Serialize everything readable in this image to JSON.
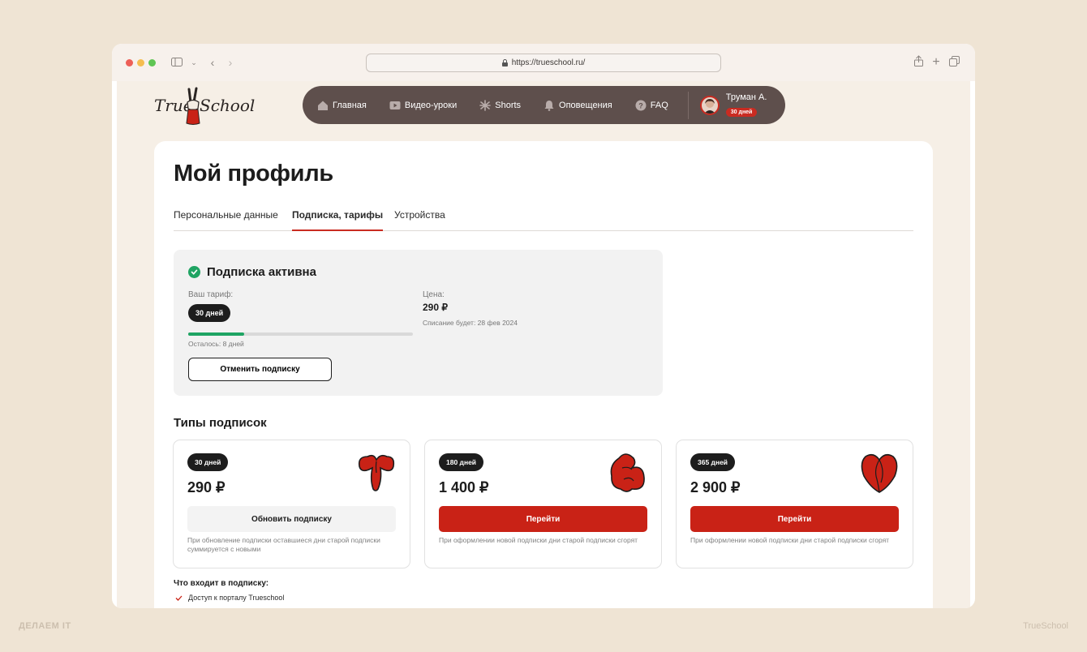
{
  "browser": {
    "url": "https://trueschool.ru/"
  },
  "brand": {
    "logo_left": "True",
    "logo_right": "School"
  },
  "nav": {
    "items": [
      {
        "label": "Главная",
        "icon": "home-icon"
      },
      {
        "label": "Видео-уроки",
        "icon": "video-icon"
      },
      {
        "label": "Shorts",
        "icon": "shorts-icon"
      },
      {
        "label": "Оповещения",
        "icon": "bell-icon"
      },
      {
        "label": "FAQ",
        "icon": "question-icon"
      }
    ],
    "user": {
      "name": "Труман А.",
      "badge": "30 дней"
    }
  },
  "profile": {
    "title": "Мой профиль",
    "tabs": [
      {
        "label": "Персональные данные",
        "active": false
      },
      {
        "label": "Подписка, тарифы",
        "active": true
      },
      {
        "label": "Устройства",
        "active": false
      }
    ]
  },
  "subscription": {
    "status": "Подписка активна",
    "tariff_label": "Ваш тариф:",
    "tariff_value": "30 дней",
    "remaining": "Осталось: 8 дней",
    "progress_fraction": 0.25,
    "cancel_label": "Отменить подписку",
    "price_label": "Цена:",
    "price_value": "290 ₽",
    "charge_note": "Списание будет: 28 фев 2024"
  },
  "plans": {
    "title": "Типы подписок",
    "items": [
      {
        "duration": "30 дней",
        "price": "290 ₽",
        "button": "Обновить подписку",
        "button_style": "grey",
        "note": "При обновление подписки оставшиеся дни старой подписки суммируется с новыми",
        "shape": "mushroom-shape"
      },
      {
        "duration": "180 дней",
        "price": "1 400 ₽",
        "button": "Перейти",
        "button_style": "red",
        "note": "При оформлении новой подписки дни старой подписки сгорят",
        "shape": "blob-shape"
      },
      {
        "duration": "365 дней",
        "price": "2 900 ₽",
        "button": "Перейти",
        "button_style": "red",
        "note": "При оформлении новой подписки дни старой подписки сгорят",
        "shape": "heart-shape"
      }
    ]
  },
  "includes": {
    "title": "Что входит в подписку:",
    "items": [
      "Доступ к порталу Trueschool"
    ]
  },
  "footer": {
    "left": "ДЕЛАЕМ IT",
    "right": "TrueSchool"
  },
  "colors": {
    "accent": "#c92216",
    "success": "#1fa463",
    "nav_bg": "#5e4f4c",
    "page_bg": "#efe4d4"
  }
}
